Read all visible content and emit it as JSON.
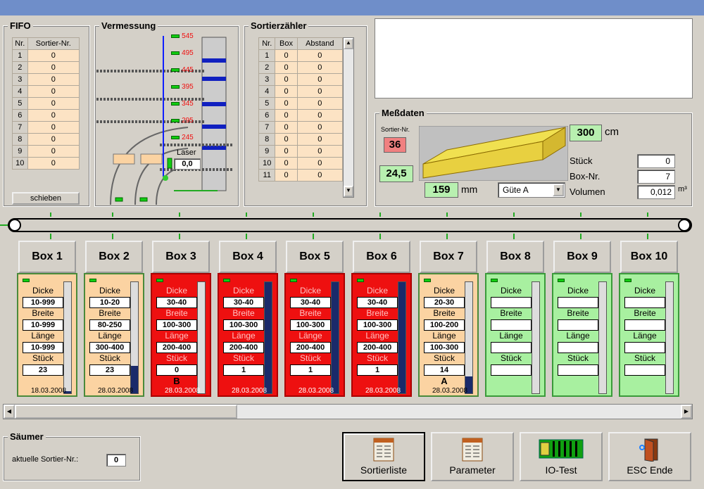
{
  "fifo": {
    "title": "FIFO",
    "col_nr": "Nr.",
    "col_sort": "Sortier-Nr.",
    "rows": [
      [
        "1",
        "0"
      ],
      [
        "2",
        "0"
      ],
      [
        "3",
        "0"
      ],
      [
        "4",
        "0"
      ],
      [
        "5",
        "0"
      ],
      [
        "6",
        "0"
      ],
      [
        "7",
        "0"
      ],
      [
        "8",
        "0"
      ],
      [
        "9",
        "0"
      ],
      [
        "10",
        "0"
      ]
    ],
    "schieben": "schieben"
  },
  "vermessung": {
    "title": "Vermessung",
    "marks": [
      "545",
      "495",
      "445",
      "395",
      "345",
      "295",
      "245"
    ],
    "laser_label": "Laser",
    "laser_value": "0,0"
  },
  "sortier": {
    "title": "Sortierzähler",
    "cols": [
      "Nr.",
      "Box",
      "Abstand"
    ],
    "rows": [
      [
        "1",
        "0",
        "0"
      ],
      [
        "2",
        "0",
        "0"
      ],
      [
        "3",
        "0",
        "0"
      ],
      [
        "4",
        "0",
        "0"
      ],
      [
        "5",
        "0",
        "0"
      ],
      [
        "6",
        "0",
        "0"
      ],
      [
        "7",
        "0",
        "0"
      ],
      [
        "8",
        "0",
        "0"
      ],
      [
        "9",
        "0",
        "0"
      ],
      [
        "10",
        "0",
        "0"
      ],
      [
        "11",
        "0",
        "0"
      ]
    ]
  },
  "mess": {
    "title": "Meßdaten",
    "sortier_label": "Sortier-Nr.",
    "sortier_value": "36",
    "thickness": "24,5",
    "length_value": "300",
    "length_unit": "cm",
    "width_value": "159",
    "width_unit": "mm",
    "guete": "Güte A",
    "stueck_label": "Stück",
    "stueck_value": "0",
    "boxnr_label": "Box-Nr.",
    "boxnr_value": "7",
    "volumen_label": "Volumen",
    "volumen_value": "0,012",
    "volumen_unit": "m³"
  },
  "labels": {
    "dicke": "Dicke",
    "breite": "Breite",
    "laenge": "Länge",
    "stueck": "Stück"
  },
  "boxes": [
    {
      "name": "Box 1",
      "dicke": "10-999",
      "breite": "10-999",
      "laenge": "10-999",
      "stueck": "23",
      "date": "18.03.2008",
      "mark": "",
      "fill": 0.02
    },
    {
      "name": "Box 2",
      "dicke": "10-20",
      "breite": "80-250",
      "laenge": "300-400",
      "stueck": "23",
      "date": "28.03.2008",
      "mark": "",
      "fill": 0.25
    },
    {
      "name": "Box 3",
      "dicke": "30-40",
      "breite": "100-300",
      "laenge": "200-400",
      "stueck": "0",
      "date": "28.03.2008",
      "mark": "B",
      "fill": 0
    },
    {
      "name": "Box 4",
      "dicke": "30-40",
      "breite": "100-300",
      "laenge": "200-400",
      "stueck": "1",
      "date": "28.03.2008",
      "mark": "",
      "fill": 1
    },
    {
      "name": "Box 5",
      "dicke": "30-40",
      "breite": "100-300",
      "laenge": "200-400",
      "stueck": "1",
      "date": "28.03.2008",
      "mark": "",
      "fill": 1
    },
    {
      "name": "Box 6",
      "dicke": "30-40",
      "breite": "100-300",
      "laenge": "200-400",
      "stueck": "1",
      "date": "28.03.2008",
      "mark": "",
      "fill": 1
    },
    {
      "name": "Box 7",
      "dicke": "20-30",
      "breite": "100-200",
      "laenge": "100-300",
      "stueck": "14",
      "date": "28.03.2008",
      "mark": "A",
      "fill": 0.15
    },
    {
      "name": "Box 8",
      "dicke": "",
      "breite": "",
      "laenge": "",
      "stueck": "",
      "date": "",
      "mark": "",
      "fill": 0
    },
    {
      "name": "Box 9",
      "dicke": "",
      "breite": "",
      "laenge": "",
      "stueck": "",
      "date": "",
      "mark": "",
      "fill": 0
    },
    {
      "name": "Box 10",
      "dicke": "",
      "breite": "",
      "laenge": "",
      "stueck": "",
      "date": "",
      "mark": "",
      "fill": 0
    }
  ],
  "saeumer": {
    "title": "Säumer",
    "label": "aktuelle Sortier-Nr.:",
    "value": "0"
  },
  "buttons": {
    "sortierliste": "Sortierliste",
    "parameter": "Parameter",
    "iotest": "IO-Test",
    "esc": "ESC Ende"
  },
  "colors": {
    "peach": "#fbd3a2",
    "red": "#ee1010",
    "green": "#a8f0a0",
    "belt_blue": "#1020c0"
  }
}
